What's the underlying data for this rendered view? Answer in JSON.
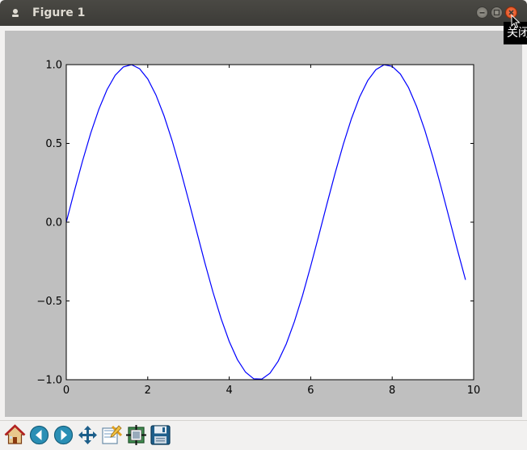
{
  "window": {
    "title": "Figure 1",
    "close_tooltip": "关闭"
  },
  "toolbar": {
    "tools": [
      {
        "name": "home-icon",
        "tip": "home"
      },
      {
        "name": "back-icon",
        "tip": "back"
      },
      {
        "name": "forward-icon",
        "tip": "forward"
      },
      {
        "name": "pan-icon",
        "tip": "pan"
      },
      {
        "name": "zoom-icon",
        "tip": "zoom"
      },
      {
        "name": "subplots-icon",
        "tip": "subplots"
      },
      {
        "name": "save-icon",
        "tip": "save"
      }
    ]
  },
  "chart_data": {
    "type": "line",
    "title": "",
    "xlabel": "",
    "ylabel": "",
    "xlim": [
      0,
      10
    ],
    "ylim": [
      -1.0,
      1.0
    ],
    "xticks": [
      "0",
      "2",
      "4",
      "6",
      "8",
      "10"
    ],
    "yticks": [
      "1.0",
      "0.5",
      "0.0",
      "−0.5",
      "−1.0"
    ],
    "ytick_values": [
      1.0,
      0.5,
      0.0,
      -0.5,
      -1.0
    ],
    "xtick_values": [
      0,
      2,
      4,
      6,
      8,
      10
    ],
    "grid": false,
    "series": [
      {
        "color": "#0000ff",
        "x": [
          0.0,
          0.2,
          0.4,
          0.6,
          0.8,
          1.0,
          1.2,
          1.4,
          1.6,
          1.8,
          2.0,
          2.2,
          2.4,
          2.6,
          2.8,
          3.0,
          3.2,
          3.4,
          3.6,
          3.8,
          4.0,
          4.2,
          4.4,
          4.6,
          4.8,
          5.0,
          5.2,
          5.4,
          5.6,
          5.8,
          6.0,
          6.2,
          6.4,
          6.6,
          6.8,
          7.0,
          7.2,
          7.4,
          7.6,
          7.8,
          8.0,
          8.2,
          8.4,
          8.6,
          8.8,
          9.0,
          9.2,
          9.4,
          9.6,
          9.8
        ],
        "y": [
          0.0,
          0.199,
          0.389,
          0.565,
          0.717,
          0.841,
          0.932,
          0.985,
          1.0,
          0.974,
          0.909,
          0.808,
          0.675,
          0.516,
          0.335,
          0.141,
          -0.058,
          -0.256,
          -0.443,
          -0.612,
          -0.757,
          -0.872,
          -0.952,
          -0.994,
          -0.996,
          -0.959,
          -0.883,
          -0.773,
          -0.631,
          -0.465,
          -0.279,
          -0.083,
          0.117,
          0.312,
          0.494,
          0.657,
          0.794,
          0.899,
          0.968,
          0.999,
          0.989,
          0.941,
          0.855,
          0.734,
          0.585,
          0.412,
          0.223,
          0.025,
          -0.174,
          -0.366
        ]
      }
    ]
  }
}
